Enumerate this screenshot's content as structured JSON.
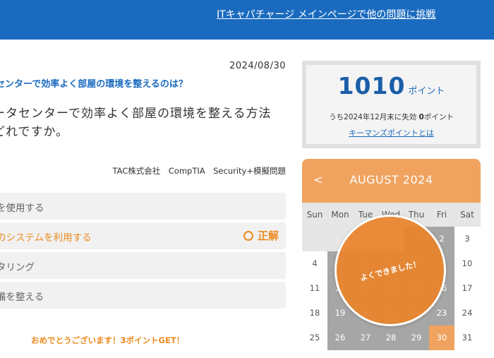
{
  "header": {
    "link_text": "ITキャパチャージ メインページで他の問題に挑戦"
  },
  "question": {
    "date": "2024/08/30",
    "title": "センターで効率よく部屋の環境を整えるのは？",
    "text": "ータセンターで効率よく部屋の環境を整える方法\nどれですか。",
    "tags": "TAC株式会社　CompTIA　Security+模擬問題"
  },
  "answers": [
    {
      "text": "を使用する",
      "correct": false
    },
    {
      "text": "のシステムを利用する",
      "correct": true
    },
    {
      "text": "タリング",
      "correct": false
    },
    {
      "text": "備を整える",
      "correct": false
    }
  ],
  "correct_label": "正解",
  "congrats": "おめでとうございます！3ポイントGET！",
  "points": {
    "value": "1010",
    "unit": "ポイント",
    "expire_prefix": "うち2024年12月末に失効 ",
    "expire_value": "0",
    "expire_suffix": "ポイント",
    "link": "キーマンズポイントとは"
  },
  "calendar": {
    "prev": "<",
    "title": "AUGUST 2024",
    "weekdays": [
      "Sun",
      "Mon",
      "Tue",
      "Wed",
      "Thu",
      "Fri",
      "Sat"
    ],
    "weeks": [
      [
        "",
        "",
        "",
        "",
        "1",
        "2",
        "3"
      ],
      [
        "4",
        "5",
        "6",
        "7",
        "8",
        "9",
        "10"
      ],
      [
        "11",
        "12",
        "13",
        "14",
        "15",
        "16",
        "17"
      ],
      [
        "18",
        "19",
        "20",
        "21",
        "22",
        "23",
        "24"
      ],
      [
        "25",
        "26",
        "27",
        "28",
        "29",
        "30",
        "31"
      ]
    ],
    "today": "30",
    "colors": {
      "header": "#f0a35f",
      "active": "#a6a6a6",
      "today": "#f0a35f",
      "plain": "#ffffff"
    }
  },
  "badge": {
    "text": "よくできました！"
  }
}
